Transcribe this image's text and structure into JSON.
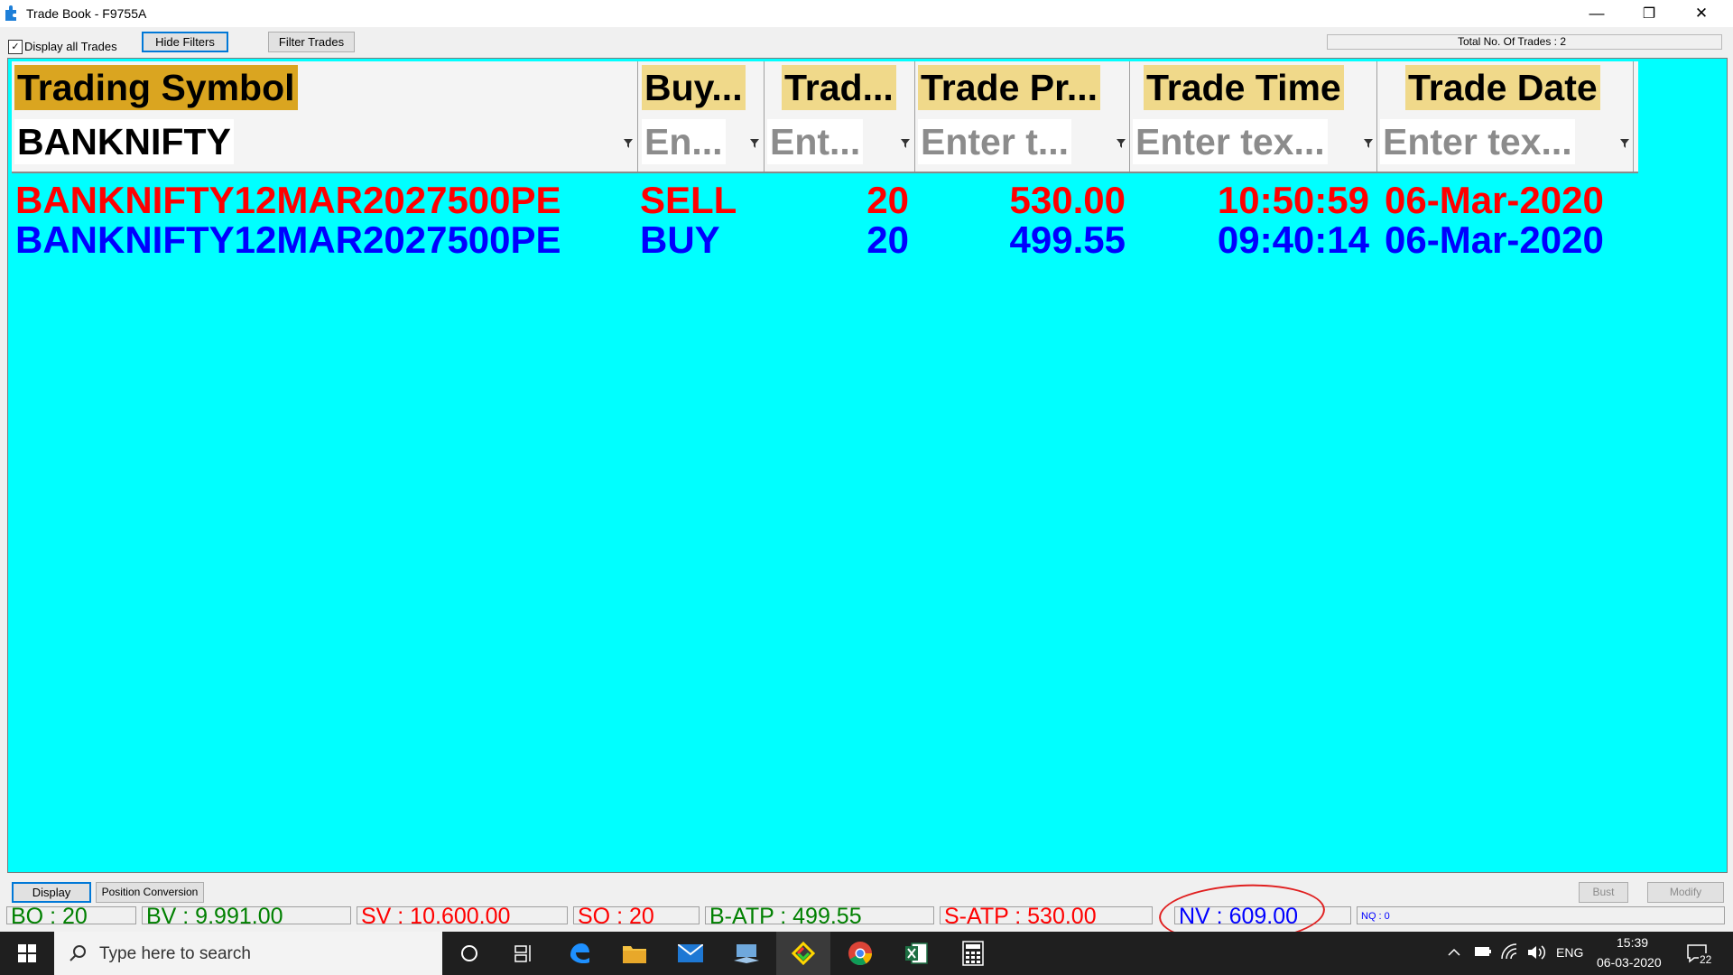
{
  "window": {
    "title": "Trade Book - F9755A",
    "minimize": "—",
    "restore": "❐",
    "close": "✕"
  },
  "toolbar": {
    "display_all_label": "Display all Trades",
    "display_all_checked": "✓",
    "hide_filters": "Hide Filters",
    "filter_trades": "Filter Trades",
    "total_trades": "Total No. Of Trades : 2"
  },
  "columns": [
    {
      "header": "Trading Symbol",
      "filter": "BANKNIFTY",
      "filter_is_placeholder": false
    },
    {
      "header": "Buy...",
      "filter": "En...",
      "filter_is_placeholder": true
    },
    {
      "header": "Trad...",
      "filter": "Ent...",
      "filter_is_placeholder": true
    },
    {
      "header": "Trade Pr...",
      "filter": "Enter t...",
      "filter_is_placeholder": true
    },
    {
      "header": "Trade Time",
      "filter": "Enter tex...",
      "filter_is_placeholder": true
    },
    {
      "header": "Trade Date",
      "filter": "Enter tex...",
      "filter_is_placeholder": true
    }
  ],
  "rows": [
    {
      "symbol": "BANKNIFTY12MAR2027500PE",
      "side": "SELL",
      "qty": "20",
      "price": "530.00",
      "time": "10:50:59",
      "date": "06-Mar-2020",
      "color": "#ff0000"
    },
    {
      "symbol": "BANKNIFTY12MAR2027500PE",
      "side": "BUY",
      "qty": "20",
      "price": "499.55",
      "time": "09:40:14",
      "date": "06-Mar-2020",
      "color": "#0000ff"
    }
  ],
  "bottom": {
    "display_button": "Display",
    "position_conversion_button": "Position Conversion",
    "bust_button": "Bust",
    "modify_button": "Modify"
  },
  "summary": [
    {
      "text": "BQ : 20",
      "color": "#008000"
    },
    {
      "text": "BV : 9,991.00",
      "color": "#008000"
    },
    {
      "text": "SV : 10,600.00",
      "color": "#ff0000"
    },
    {
      "text": "SQ : 20",
      "color": "#ff0000"
    },
    {
      "text": "B-ATP : 499.55",
      "color": "#008000"
    },
    {
      "text": "S-ATP : 530.00",
      "color": "#ff0000"
    },
    {
      "text": "NV : 609.00",
      "color": "#0000ff"
    },
    {
      "text": "NQ : 0",
      "color": "#0000ff"
    }
  ],
  "taskbar": {
    "search_placeholder": "Type here to search",
    "language": "ENG",
    "time": "15:39",
    "date": "06-03-2020",
    "notifications": "22"
  },
  "colors": {
    "grid_background": "#00ffff",
    "header_highlight": "#daa520",
    "sell": "#ff0000",
    "buy": "#0000ff",
    "annotation_circle": "#e02020"
  }
}
